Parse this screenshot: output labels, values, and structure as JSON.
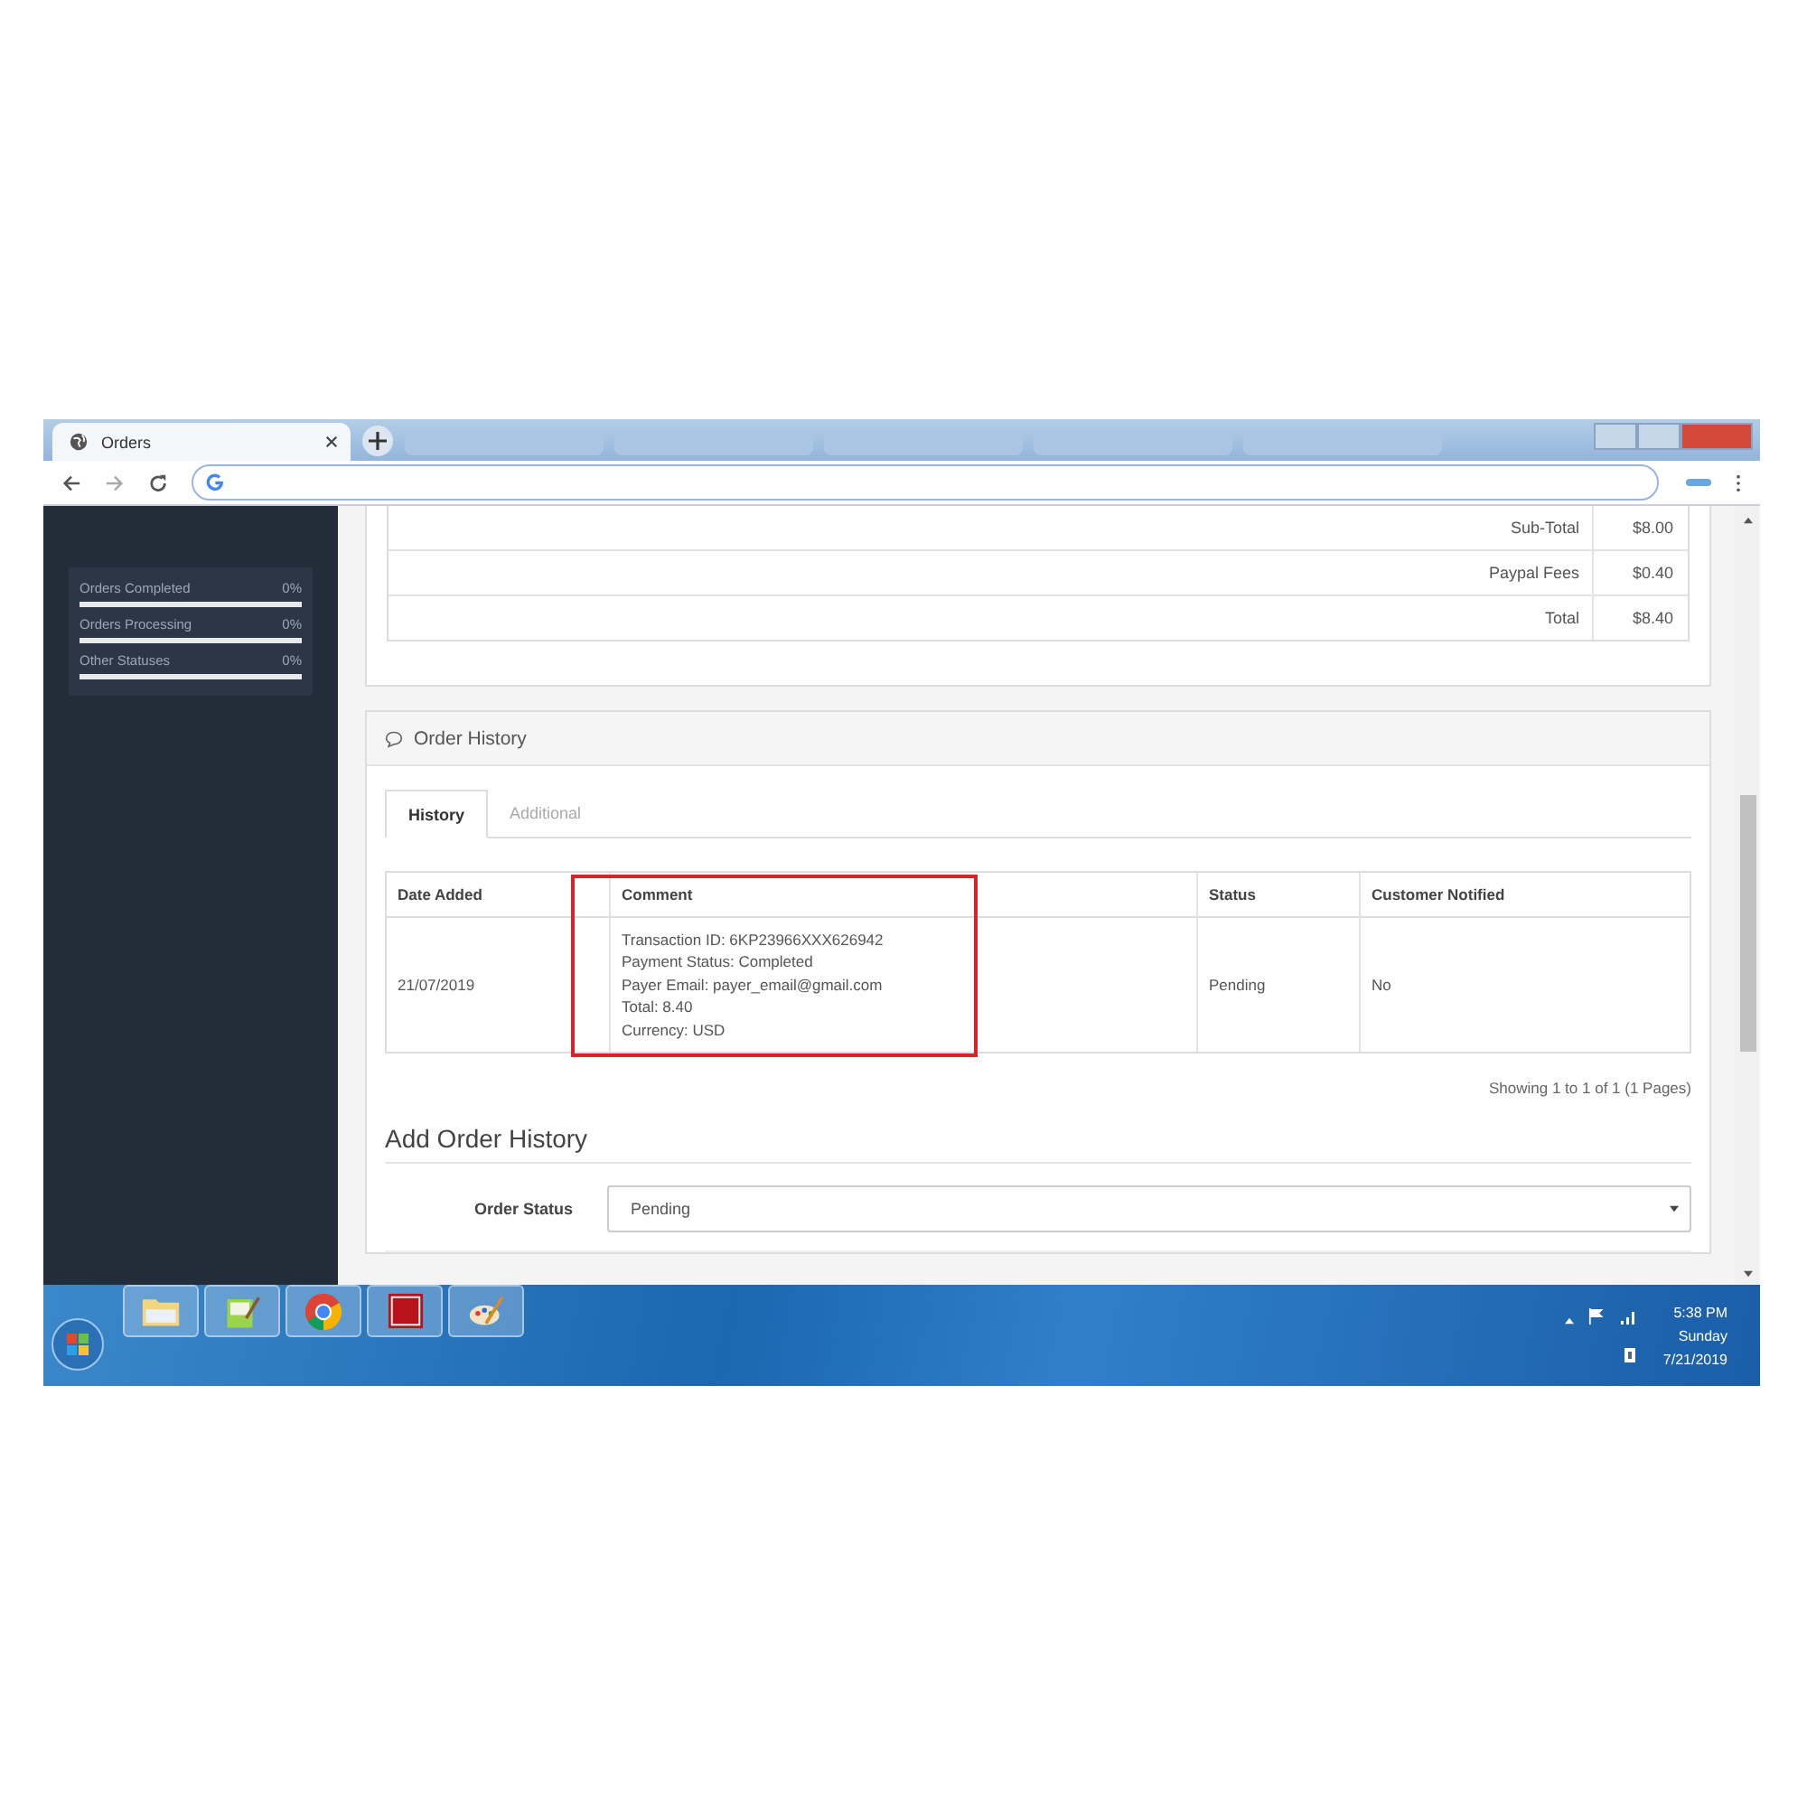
{
  "browser": {
    "tabs": [
      {
        "title": "Orders",
        "selected": true
      }
    ]
  },
  "sidebar": {
    "stats": [
      {
        "label": "Orders Completed",
        "value": "0%",
        "level": 0
      },
      {
        "label": "Orders Processing",
        "value": "0%",
        "level": 0
      },
      {
        "label": "Other Statuses",
        "value": "0%",
        "level": 0
      }
    ]
  },
  "totals": [
    {
      "label": "Sub-Total",
      "value": "$8.00"
    },
    {
      "label": "Paypal Fees",
      "value": "$0.40"
    },
    {
      "label": "Total",
      "value": "$8.40"
    }
  ],
  "order_history": {
    "title": "Order History",
    "tabs": [
      {
        "label": "History",
        "selected": true
      },
      {
        "label": "Additional",
        "selected": false
      }
    ],
    "columns": [
      {
        "label": "Date Added"
      },
      {
        "label": "Comment"
      },
      {
        "label": "Status"
      },
      {
        "label": "Customer Notified"
      }
    ],
    "annotation": {
      "kind": "box"
    },
    "rows": [
      {
        "date_added": "21/07/2019",
        "comment": [
          "Transaction ID: 6KP23966XXX626942",
          "Payment Status: Completed",
          "Payer Email: payer_email@gmail.com",
          "Total: 8.40",
          "Currency: USD"
        ],
        "status": "Pending",
        "customer_notified": "No"
      }
    ],
    "pagination": "Showing 1 to 1 of 1 (1 Pages)"
  },
  "add_order_history": {
    "title": "Add Order History",
    "fields": [
      {
        "label": "Order Status",
        "value": "Pending"
      }
    ]
  },
  "taskbar": {
    "apps": [
      {
        "kind": "folder"
      },
      {
        "kind": "notepad"
      },
      {
        "kind": "chrome"
      },
      {
        "kind": "filezilla"
      },
      {
        "kind": "paint"
      }
    ],
    "clock": {
      "time": "5:38 PM",
      "day": "Sunday",
      "date": "7/21/2019"
    }
  }
}
